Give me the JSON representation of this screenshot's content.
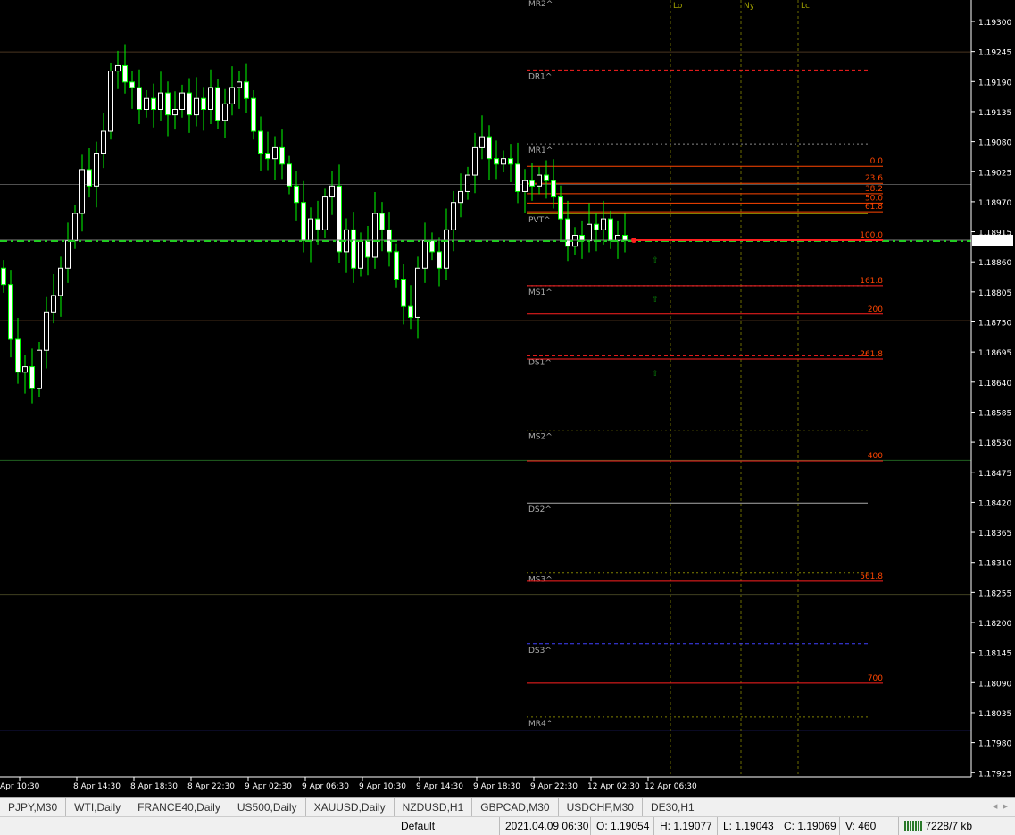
{
  "price_axis": {
    "labels": [
      "1.19300",
      "1.19245",
      "1.19190",
      "1.19135",
      "1.19080",
      "1.19025",
      "1.18970",
      "1.18915",
      "1.18860",
      "1.18805",
      "1.18750",
      "1.18695",
      "1.18640",
      "1.18585",
      "1.18530",
      "1.18475",
      "1.18420",
      "1.18365",
      "1.18310",
      "1.18255",
      "1.18200",
      "1.18145",
      "1.18090",
      "1.18035",
      "1.17980",
      "1.17925"
    ],
    "current_price": "1.18901",
    "current_price_value": 1.18901
  },
  "time_axis": [
    "Apr 10:30",
    "8 Apr 14:30",
    "8 Apr 18:30",
    "8 Apr 22:30",
    "9 Apr 02:30",
    "9 Apr 06:30",
    "9 Apr 10:30",
    "9 Apr 14:30",
    "9 Apr 18:30",
    "9 Apr 22:30",
    "12 Apr 02:30",
    "12 Apr 06:30"
  ],
  "candles_close": [
    1.1882,
    1.1872,
    1.1866,
    1.1867,
    1.1863,
    1.187,
    1.1877,
    1.188,
    1.1885,
    1.189,
    1.1895,
    1.1903,
    1.19,
    1.1906,
    1.191,
    1.1921,
    1.1922,
    1.1919,
    1.1918,
    1.1914,
    1.1916,
    1.1914,
    1.1917,
    1.1913,
    1.1914,
    1.1917,
    1.1913,
    1.1916,
    1.1914,
    1.1918,
    1.1912,
    1.1915,
    1.1918,
    1.1919,
    1.1916,
    1.191,
    1.1906,
    1.1905,
    1.1907,
    1.1904,
    1.19,
    1.1897,
    1.189,
    1.1894,
    1.1892,
    1.1898,
    1.19,
    1.1888,
    1.1892,
    1.1885,
    1.189,
    1.1887,
    1.1895,
    1.1892,
    1.1888,
    1.1883,
    1.1878,
    1.1876,
    1.1885,
    1.189,
    1.1888,
    1.1885,
    1.1892,
    1.1897,
    1.1899,
    1.1902,
    1.1907,
    1.1909,
    1.1905,
    1.1904,
    1.1905,
    1.1904,
    1.1899,
    1.1901,
    1.19,
    1.1902,
    1.1901,
    1.1898,
    1.1894,
    1.1889,
    1.1891,
    1.189,
    1.1893,
    1.1892,
    1.1894,
    1.189,
    1.1891,
    1.189
  ],
  "pivots": [
    {
      "label": "MR2^",
      "price": 1.19345,
      "color": "#888888",
      "style": "dot"
    },
    {
      "label": "DR1^",
      "price": 1.19212,
      "color": "#ff2020",
      "style": "dash"
    },
    {
      "label": "MR1^",
      "price": 1.19077,
      "color": "#888888",
      "style": "dot"
    },
    {
      "label": "PVT^",
      "price": 1.1895,
      "color": "#ffff00",
      "style": "solid"
    },
    {
      "label": "MS1^",
      "price": 1.18818,
      "color": "#888888",
      "style": "dot"
    },
    {
      "label": "DS1^",
      "price": 1.1869,
      "color": "#ff2020",
      "style": "dash"
    },
    {
      "label": "MS2^",
      "price": 1.18554,
      "color": "#808000",
      "style": "dot"
    },
    {
      "label": "DS2^",
      "price": 1.18421,
      "color": "#aaaaaa",
      "style": "solid"
    },
    {
      "label": "MS3^",
      "price": 1.18293,
      "color": "#808000",
      "style": "dot"
    },
    {
      "label": "DS3^",
      "price": 1.18164,
      "color": "#4040ff",
      "style": "dash"
    },
    {
      "label": "MR4^",
      "price": 1.1803,
      "color": "#808000",
      "style": "dot"
    }
  ],
  "fib_levels": [
    {
      "label": "0.0",
      "price": 1.19036
    },
    {
      "label": "23.6",
      "price": 1.19005
    },
    {
      "label": "38.2",
      "price": 1.18986
    },
    {
      "label": "50.0",
      "price": 1.18969
    },
    {
      "label": "61.8",
      "price": 1.18953
    },
    {
      "label": "100.0",
      "price": 1.18901
    },
    {
      "label": "161.8",
      "price": 1.18818
    },
    {
      "label": "200",
      "price": 1.18766
    },
    {
      "label": "261.8",
      "price": 1.18684
    },
    {
      "label": "400",
      "price": 1.18498
    },
    {
      "label": "561.8",
      "price": 1.18278
    },
    {
      "label": "700",
      "price": 1.18092
    }
  ],
  "hlines": [
    {
      "price": 1.19245,
      "color": "#4a3520"
    },
    {
      "price": 1.19003,
      "color": "#505050"
    },
    {
      "price": 1.18754,
      "color": "#5a3a20"
    },
    {
      "price": 1.18499,
      "color": "#206020"
    },
    {
      "price": 1.18254,
      "color": "#404020"
    },
    {
      "price": 1.18005,
      "color": "#2a2a90"
    }
  ],
  "sessions": [
    {
      "label": "Lo"
    },
    {
      "label": "Ny"
    },
    {
      "label": "Lc"
    }
  ],
  "colors": {
    "bull": "#ffffff",
    "wick": "#00ff00",
    "fib": "#ff4500",
    "session": "#6b6b00"
  },
  "tabs": [
    "PJPY,M30",
    "WTI,Daily",
    "FRANCE40,Daily",
    "US500,Daily",
    "XAUUSD,Daily",
    "NZDUSD,H1",
    "GBPCAD,M30",
    "USDCHF,M30",
    "DE30,H1"
  ],
  "status": {
    "profile": "Default",
    "datetime": "2021.04.09 06:30",
    "open": "O: 1.19054",
    "high": "H: 1.19077",
    "low": "L: 1.19043",
    "close": "C: 1.19069",
    "volume": "V: 460",
    "traffic": "7228/7 kb"
  }
}
